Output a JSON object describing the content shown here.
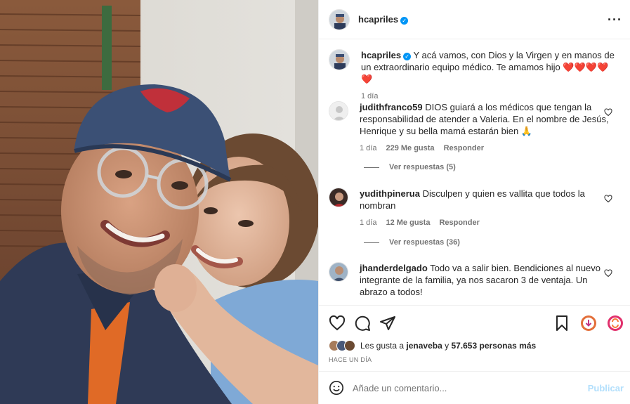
{
  "post": {
    "username": "hcapriles",
    "verified_icon": "verified-badge-icon",
    "more_icon": "more-options-icon"
  },
  "caption": {
    "username": "hcapriles",
    "text": "Y acá vamos, con Dios y la Virgen y en manos de un extraordinario equipo médico. Te amamos hijo",
    "hearts": "❤️❤️❤️❤️❤️",
    "time": "1 día"
  },
  "comments": [
    {
      "username": "judithfranco59",
      "text": "DIOS guiará a los médicos que tengan la responsabilidad de atender a Valeria. En el nombre de Jesús, Henrique y su bella mamá estarán bien 🙏",
      "time": "1 día",
      "likes": "229 Me gusta",
      "reply": "Responder",
      "view_replies": "Ver respuestas (5)"
    },
    {
      "username": "yudithpinerua",
      "text": "Disculpen y quien es vallita que todos la nombran",
      "time": "1 día",
      "likes": "12 Me gusta",
      "reply": "Responder",
      "view_replies": "Ver respuestas (36)"
    },
    {
      "username": "jhanderdelgado",
      "text": "Todo va a salir bien. Bendiciones al nuevo integrante de la familia, ya nos sacaron 3 de ventaja. Un abrazo a todos!"
    }
  ],
  "likes": {
    "prefix": "Les gusta a",
    "user": "jenaveba",
    "joiner": "y",
    "count": "57.653 personas más"
  },
  "time_ago": "HACE UN DÍA",
  "add_comment": {
    "placeholder": "Añade un comentario...",
    "publish": "Publicar"
  },
  "colors": {
    "accent_blue": "#0095f6",
    "publish_disabled": "#b2dffc",
    "heart_red": "#e0245e",
    "muted": "#737373"
  }
}
